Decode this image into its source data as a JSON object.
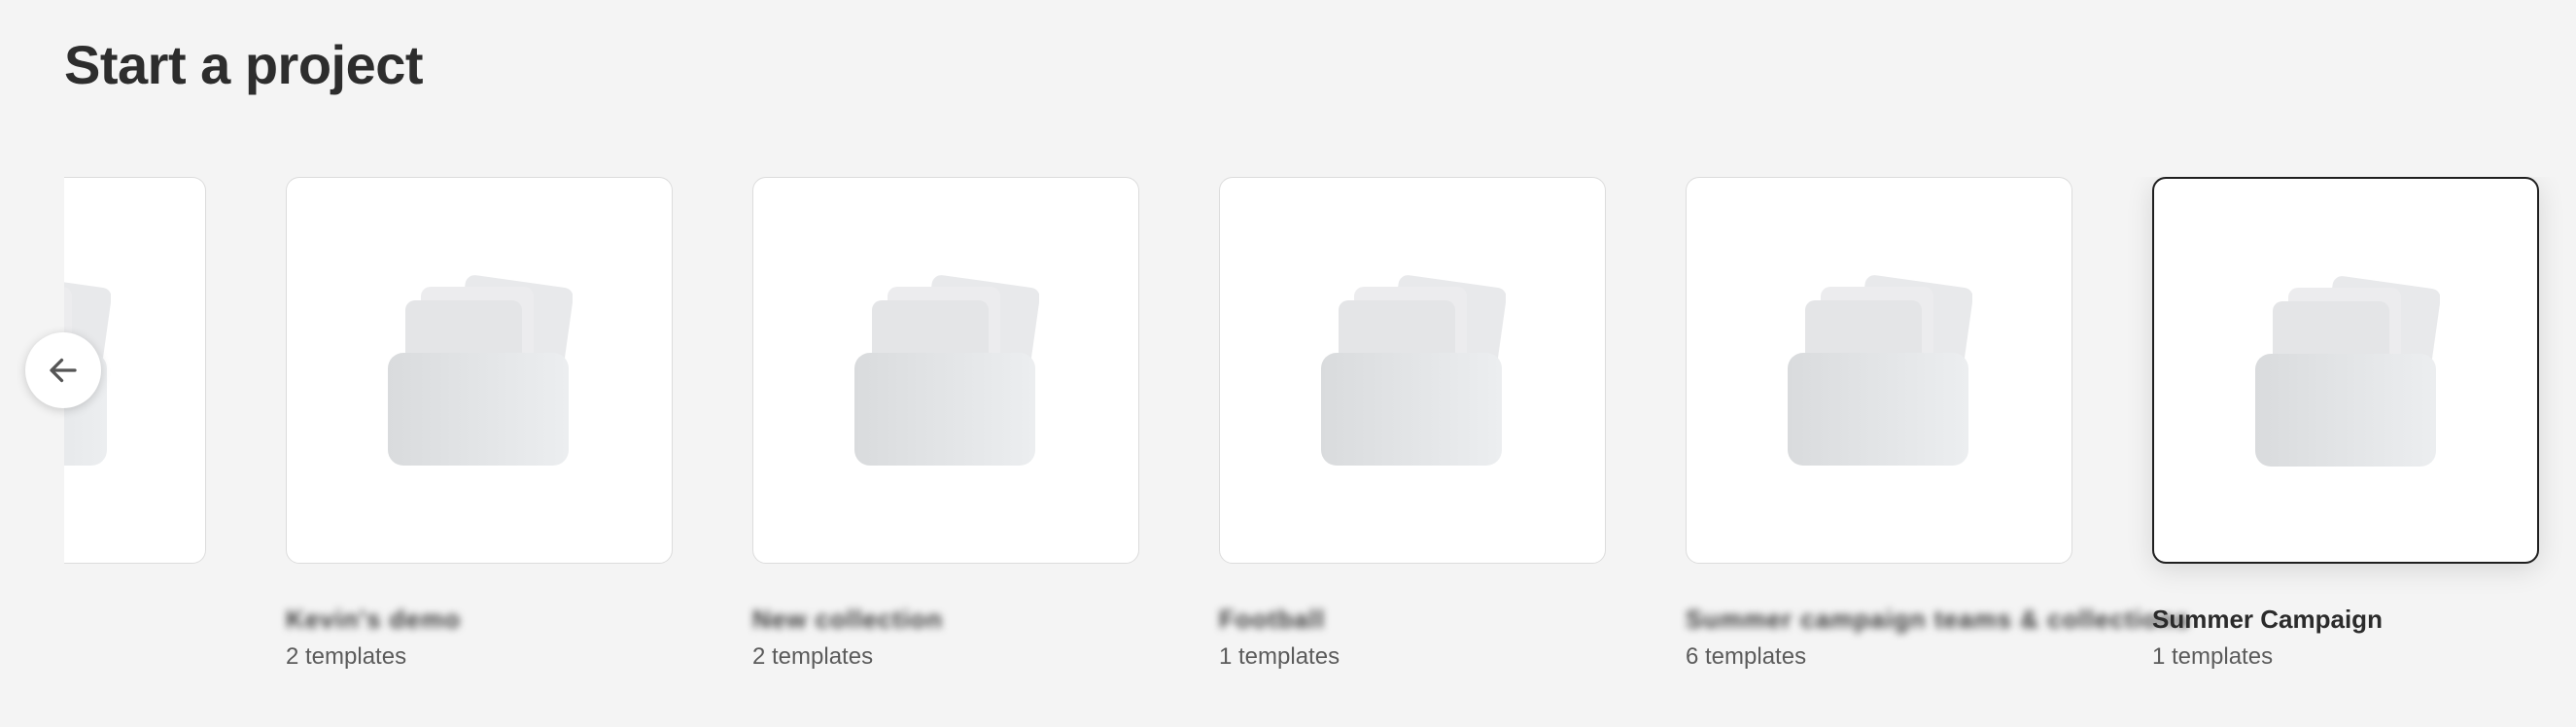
{
  "page": {
    "title": "Start a project"
  },
  "carousel": {
    "prev_icon": "arrow-left-icon",
    "cards": [
      {
        "name": "",
        "count": ""
      },
      {
        "name": "Kevin's demo",
        "count": "2 templates",
        "redacted": true
      },
      {
        "name": "New collection",
        "count": "2 templates",
        "redacted": true
      },
      {
        "name": "Football",
        "count": "1 templates",
        "redacted": true
      },
      {
        "name": "Summer campaign teams & collections",
        "count": "6 templates",
        "redacted": true
      },
      {
        "name": "Summer Campaign",
        "count": "1 templates",
        "redacted": false,
        "selected": true
      }
    ]
  },
  "colors": {
    "background": "#f4f4f4",
    "card_border": "#dcdcdc",
    "selected_border": "#1f1f1f",
    "folder_gray": "#dcdee0"
  }
}
